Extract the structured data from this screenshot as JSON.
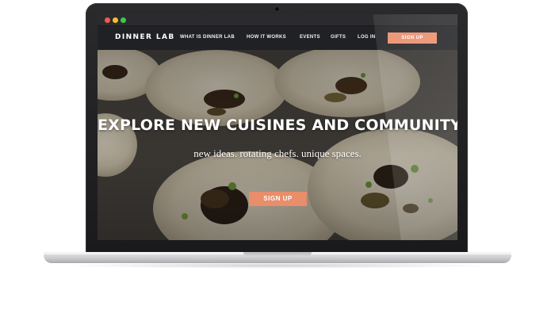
{
  "window": {
    "controls": [
      "close",
      "minimize",
      "maximize"
    ]
  },
  "nav": {
    "logo": "DINNER LAB",
    "links": [
      "WHAT IS DINNER LAB",
      "HOW IT WORKS",
      "EVENTS",
      "GIFTS",
      "LOG IN"
    ],
    "signup_label": "SIGN UP"
  },
  "hero": {
    "title": "EXPLORE NEW CUISINES AND COMMUNITY",
    "subtitle": "new ideas. rotating chefs. unique spaces.",
    "cta_label": "SIGN UP"
  },
  "colors": {
    "accent": "#e98d6a",
    "navbar": "#202124",
    "frame": "#1e1e20"
  }
}
